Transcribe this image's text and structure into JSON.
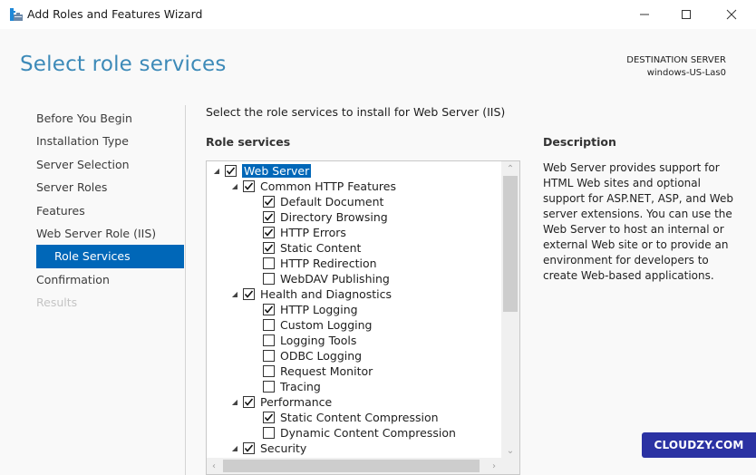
{
  "window": {
    "title": "Add Roles and Features Wizard",
    "icon": "server-manager-icon",
    "controls": {
      "minimize": "minimize-icon",
      "maximize": "maximize-icon",
      "close": "close-icon"
    }
  },
  "header": {
    "page_title": "Select role services",
    "destination_label": "DESTINATION SERVER",
    "destination_server": "windows-US-Las0"
  },
  "nav": {
    "items": [
      {
        "label": "Before You Begin",
        "state": "normal"
      },
      {
        "label": "Installation Type",
        "state": "normal"
      },
      {
        "label": "Server Selection",
        "state": "normal"
      },
      {
        "label": "Server Roles",
        "state": "normal"
      },
      {
        "label": "Features",
        "state": "normal"
      },
      {
        "label": "Web Server Role (IIS)",
        "state": "normal"
      },
      {
        "label": "Role Services",
        "state": "active"
      },
      {
        "label": "Confirmation",
        "state": "normal"
      },
      {
        "label": "Results",
        "state": "disabled"
      }
    ]
  },
  "main": {
    "instruction": "Select the role services to install for Web Server (IIS)",
    "role_services_label": "Role services",
    "tree": [
      {
        "label": "Web Server",
        "checked": true,
        "level": 0,
        "expandable": true,
        "selected": true
      },
      {
        "label": "Common HTTP Features",
        "checked": true,
        "level": 1,
        "expandable": true
      },
      {
        "label": "Default Document",
        "checked": true,
        "level": 2
      },
      {
        "label": "Directory Browsing",
        "checked": true,
        "level": 2
      },
      {
        "label": "HTTP Errors",
        "checked": true,
        "level": 2
      },
      {
        "label": "Static Content",
        "checked": true,
        "level": 2
      },
      {
        "label": "HTTP Redirection",
        "checked": false,
        "level": 2
      },
      {
        "label": "WebDAV Publishing",
        "checked": false,
        "level": 2
      },
      {
        "label": "Health and Diagnostics",
        "checked": true,
        "level": 1,
        "expandable": true
      },
      {
        "label": "HTTP Logging",
        "checked": true,
        "level": 2
      },
      {
        "label": "Custom Logging",
        "checked": false,
        "level": 2
      },
      {
        "label": "Logging Tools",
        "checked": false,
        "level": 2
      },
      {
        "label": "ODBC Logging",
        "checked": false,
        "level": 2
      },
      {
        "label": "Request Monitor",
        "checked": false,
        "level": 2
      },
      {
        "label": "Tracing",
        "checked": false,
        "level": 2
      },
      {
        "label": "Performance",
        "checked": true,
        "level": 1,
        "expandable": true
      },
      {
        "label": "Static Content Compression",
        "checked": true,
        "level": 2
      },
      {
        "label": "Dynamic Content Compression",
        "checked": false,
        "level": 2
      },
      {
        "label": "Security",
        "checked": true,
        "level": 1,
        "expandable": true
      }
    ],
    "description_label": "Description",
    "description_text": "Web Server provides support for HTML Web sites and optional support for ASP.NET, ASP, and Web server extensions. You can use the Web Server to host an internal or external Web site or to provide an environment for developers to create Web-based applications."
  },
  "watermark": {
    "label": "CLOUDZY.COM",
    "color": "#2b32a3"
  },
  "colors": {
    "accent": "#0067b8",
    "title": "#3d8ab8"
  }
}
